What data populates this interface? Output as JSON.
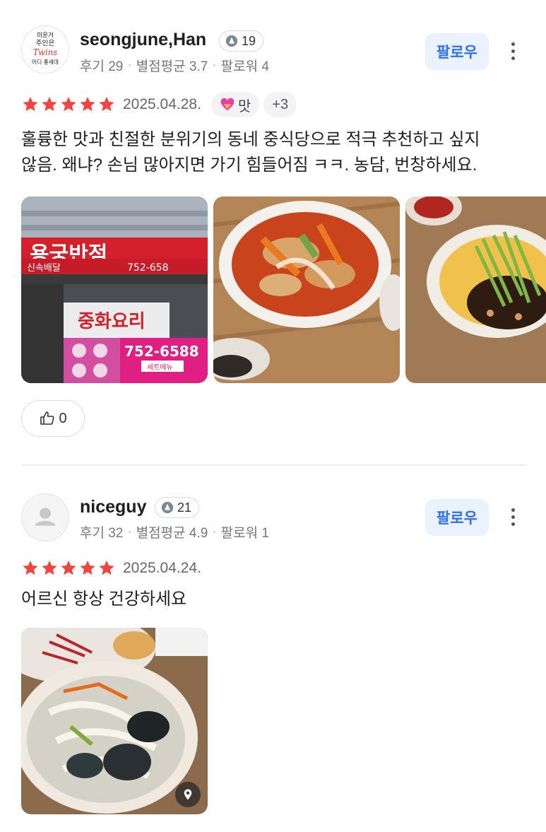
{
  "reviews": [
    {
      "user": {
        "name": "seongjune,Han",
        "level": "19",
        "avatar_text": [
          "미운거",
          "주인은",
          "Twins",
          "어디 좋세데"
        ],
        "stats": [
          "후기 29",
          "별점평균 3.7",
          "팔로워 4"
        ]
      },
      "follow_label": "팔로우",
      "rating": 5,
      "date": "2025.04.28.",
      "tags": [
        {
          "icon": "heart-taste-icon",
          "label": "맛"
        }
      ],
      "more_tags": "+3",
      "text_lines": [
        "훌륭한 맛과 친절한 분위기의 동네 중식당으로 적극 추천하고 싶지",
        "않음. 왜냐? 손님 많아지면 가기 힘들어짐 ㅋㅋ. 농담, 번창하세요."
      ],
      "photo_signs": {
        "store_name": "용궁반점",
        "delivery": "신속배달",
        "phone_top": "752-658",
        "cuisine": "중화요리",
        "phone_big": "752-6588",
        "set_menu": "세트메뉴"
      },
      "likes": "0"
    },
    {
      "user": {
        "name": "niceguy",
        "level": "21",
        "stats": [
          "후기 32",
          "별점평균 4.9",
          "팔로워 1"
        ]
      },
      "follow_label": "팔로우",
      "rating": 5,
      "date": "2025.04.24.",
      "text_lines": [
        "어르신 항상 건강하세요"
      ]
    }
  ],
  "colors": {
    "star": "#f2453d",
    "follow_bg": "#eaf2ff",
    "follow_text": "#2f6ff0"
  }
}
